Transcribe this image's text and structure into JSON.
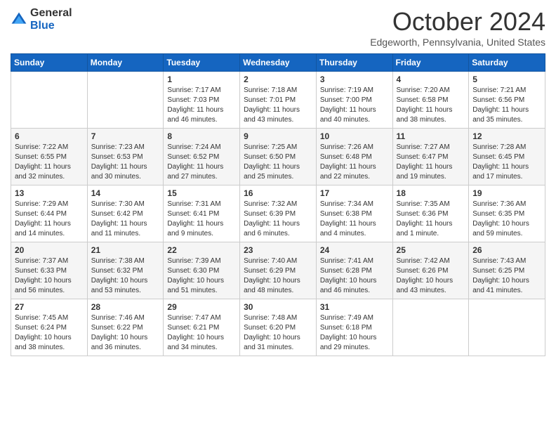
{
  "header": {
    "logo_general": "General",
    "logo_blue": "Blue",
    "title": "October 2024",
    "location": "Edgeworth, Pennsylvania, United States"
  },
  "days_of_week": [
    "Sunday",
    "Monday",
    "Tuesday",
    "Wednesday",
    "Thursday",
    "Friday",
    "Saturday"
  ],
  "weeks": [
    [
      {
        "day": "",
        "info": ""
      },
      {
        "day": "",
        "info": ""
      },
      {
        "day": "1",
        "info": "Sunrise: 7:17 AM\nSunset: 7:03 PM\nDaylight: 11 hours and 46 minutes."
      },
      {
        "day": "2",
        "info": "Sunrise: 7:18 AM\nSunset: 7:01 PM\nDaylight: 11 hours and 43 minutes."
      },
      {
        "day": "3",
        "info": "Sunrise: 7:19 AM\nSunset: 7:00 PM\nDaylight: 11 hours and 40 minutes."
      },
      {
        "day": "4",
        "info": "Sunrise: 7:20 AM\nSunset: 6:58 PM\nDaylight: 11 hours and 38 minutes."
      },
      {
        "day": "5",
        "info": "Sunrise: 7:21 AM\nSunset: 6:56 PM\nDaylight: 11 hours and 35 minutes."
      }
    ],
    [
      {
        "day": "6",
        "info": "Sunrise: 7:22 AM\nSunset: 6:55 PM\nDaylight: 11 hours and 32 minutes."
      },
      {
        "day": "7",
        "info": "Sunrise: 7:23 AM\nSunset: 6:53 PM\nDaylight: 11 hours and 30 minutes."
      },
      {
        "day": "8",
        "info": "Sunrise: 7:24 AM\nSunset: 6:52 PM\nDaylight: 11 hours and 27 minutes."
      },
      {
        "day": "9",
        "info": "Sunrise: 7:25 AM\nSunset: 6:50 PM\nDaylight: 11 hours and 25 minutes."
      },
      {
        "day": "10",
        "info": "Sunrise: 7:26 AM\nSunset: 6:48 PM\nDaylight: 11 hours and 22 minutes."
      },
      {
        "day": "11",
        "info": "Sunrise: 7:27 AM\nSunset: 6:47 PM\nDaylight: 11 hours and 19 minutes."
      },
      {
        "day": "12",
        "info": "Sunrise: 7:28 AM\nSunset: 6:45 PM\nDaylight: 11 hours and 17 minutes."
      }
    ],
    [
      {
        "day": "13",
        "info": "Sunrise: 7:29 AM\nSunset: 6:44 PM\nDaylight: 11 hours and 14 minutes."
      },
      {
        "day": "14",
        "info": "Sunrise: 7:30 AM\nSunset: 6:42 PM\nDaylight: 11 hours and 11 minutes."
      },
      {
        "day": "15",
        "info": "Sunrise: 7:31 AM\nSunset: 6:41 PM\nDaylight: 11 hours and 9 minutes."
      },
      {
        "day": "16",
        "info": "Sunrise: 7:32 AM\nSunset: 6:39 PM\nDaylight: 11 hours and 6 minutes."
      },
      {
        "day": "17",
        "info": "Sunrise: 7:34 AM\nSunset: 6:38 PM\nDaylight: 11 hours and 4 minutes."
      },
      {
        "day": "18",
        "info": "Sunrise: 7:35 AM\nSunset: 6:36 PM\nDaylight: 11 hours and 1 minute."
      },
      {
        "day": "19",
        "info": "Sunrise: 7:36 AM\nSunset: 6:35 PM\nDaylight: 10 hours and 59 minutes."
      }
    ],
    [
      {
        "day": "20",
        "info": "Sunrise: 7:37 AM\nSunset: 6:33 PM\nDaylight: 10 hours and 56 minutes."
      },
      {
        "day": "21",
        "info": "Sunrise: 7:38 AM\nSunset: 6:32 PM\nDaylight: 10 hours and 53 minutes."
      },
      {
        "day": "22",
        "info": "Sunrise: 7:39 AM\nSunset: 6:30 PM\nDaylight: 10 hours and 51 minutes."
      },
      {
        "day": "23",
        "info": "Sunrise: 7:40 AM\nSunset: 6:29 PM\nDaylight: 10 hours and 48 minutes."
      },
      {
        "day": "24",
        "info": "Sunrise: 7:41 AM\nSunset: 6:28 PM\nDaylight: 10 hours and 46 minutes."
      },
      {
        "day": "25",
        "info": "Sunrise: 7:42 AM\nSunset: 6:26 PM\nDaylight: 10 hours and 43 minutes."
      },
      {
        "day": "26",
        "info": "Sunrise: 7:43 AM\nSunset: 6:25 PM\nDaylight: 10 hours and 41 minutes."
      }
    ],
    [
      {
        "day": "27",
        "info": "Sunrise: 7:45 AM\nSunset: 6:24 PM\nDaylight: 10 hours and 38 minutes."
      },
      {
        "day": "28",
        "info": "Sunrise: 7:46 AM\nSunset: 6:22 PM\nDaylight: 10 hours and 36 minutes."
      },
      {
        "day": "29",
        "info": "Sunrise: 7:47 AM\nSunset: 6:21 PM\nDaylight: 10 hours and 34 minutes."
      },
      {
        "day": "30",
        "info": "Sunrise: 7:48 AM\nSunset: 6:20 PM\nDaylight: 10 hours and 31 minutes."
      },
      {
        "day": "31",
        "info": "Sunrise: 7:49 AM\nSunset: 6:18 PM\nDaylight: 10 hours and 29 minutes."
      },
      {
        "day": "",
        "info": ""
      },
      {
        "day": "",
        "info": ""
      }
    ]
  ]
}
